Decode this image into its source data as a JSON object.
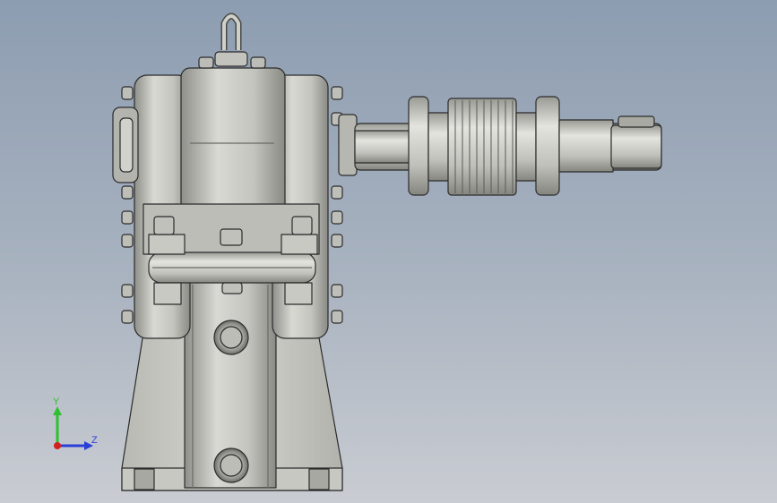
{
  "viewport": {
    "background_top": "#8d9db1",
    "background_bottom": "#c9ccd2"
  },
  "model": {
    "description_icon": "gear-reducer-model",
    "body_color": "#c7c7c2",
    "shadow_color": "#9a9a95",
    "outline_color": "#2b2b2b"
  },
  "triad": {
    "y_label": "Y",
    "z_label": "Z",
    "y_color": "#2fbf2f",
    "z_color": "#2a3fd8",
    "x_color": "#d42020"
  }
}
